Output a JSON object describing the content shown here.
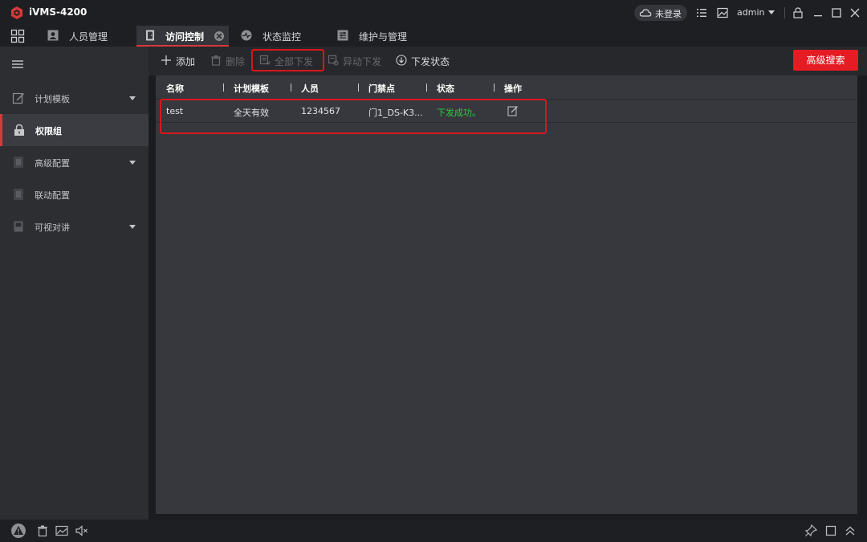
{
  "app": {
    "title": "iVMS-4200",
    "brand_color": "#d8383a"
  },
  "titlebar": {
    "login_status": "未登录",
    "user": "admin",
    "icons": [
      "cloud-icon",
      "list-icon",
      "picture-icon",
      "lock-icon",
      "minimize-icon",
      "maximize-icon",
      "close-icon"
    ]
  },
  "tabs": [
    {
      "label": "人员管理",
      "icon": "person-card-icon",
      "active": false
    },
    {
      "label": "访问控制",
      "icon": "door-icon",
      "active": true
    },
    {
      "label": "状态监控",
      "icon": "monitor-icon",
      "active": false
    },
    {
      "label": "维护与管理",
      "icon": "settings-panel-icon",
      "active": false
    }
  ],
  "sidebar": {
    "items": [
      {
        "label": "计划模板",
        "expandable": true
      },
      {
        "label": "权限组",
        "expandable": false,
        "active": true
      },
      {
        "label": "高级配置",
        "expandable": true
      },
      {
        "label": "联动配置",
        "expandable": false
      },
      {
        "label": "可视对讲",
        "expandable": true
      }
    ]
  },
  "toolbar": {
    "add": "添加",
    "delete": "删除",
    "apply_all": "全部下发",
    "apply_changed": "异动下发",
    "apply_status": "下发状态",
    "advanced_search": "高级搜索",
    "accent_color": "#e51c23"
  },
  "table": {
    "columns": [
      "名称",
      "计划模板",
      "人员",
      "门禁点",
      "状态",
      "操作"
    ],
    "rows": [
      {
        "name": "test",
        "template": "全天有效",
        "person": "1234567",
        "door": "门1_DS-K3...",
        "status": "下发成功。",
        "status_color": "#2fc742"
      }
    ]
  }
}
